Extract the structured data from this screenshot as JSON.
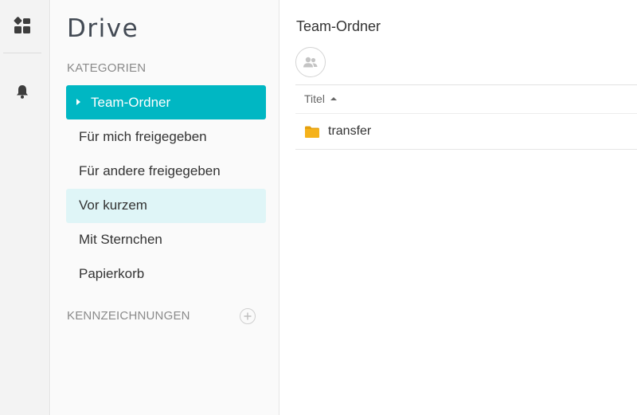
{
  "app": {
    "logo_text": "Drive"
  },
  "rail": {
    "items": [
      {
        "icon": "apps-grid-icon"
      },
      {
        "icon": "bell-icon"
      }
    ]
  },
  "sidebar": {
    "categories_title": "KATEGORIEN",
    "items": [
      {
        "label": "Team-Ordner",
        "state": "active"
      },
      {
        "label": "Für mich freigegeben",
        "state": "normal"
      },
      {
        "label": "Für andere freigegeben",
        "state": "normal"
      },
      {
        "label": "Vor kurzem",
        "state": "hover"
      },
      {
        "label": "Mit Sternchen",
        "state": "normal"
      },
      {
        "label": "Papierkorb",
        "state": "normal"
      }
    ],
    "tags_title": "KENNZEICHNUNGEN",
    "add_tag_icon": "plus-circle-icon"
  },
  "main": {
    "title": "Team-Ordner",
    "share_icon": "people-icon",
    "columns": [
      {
        "label": "Titel",
        "sort": "ascending"
      }
    ],
    "rows": [
      {
        "icon": "folder-icon",
        "name": "transfer"
      }
    ]
  },
  "colors": {
    "accent": "#00b7c3",
    "hover": "#dff5f7",
    "folder": "#f5b21b"
  }
}
